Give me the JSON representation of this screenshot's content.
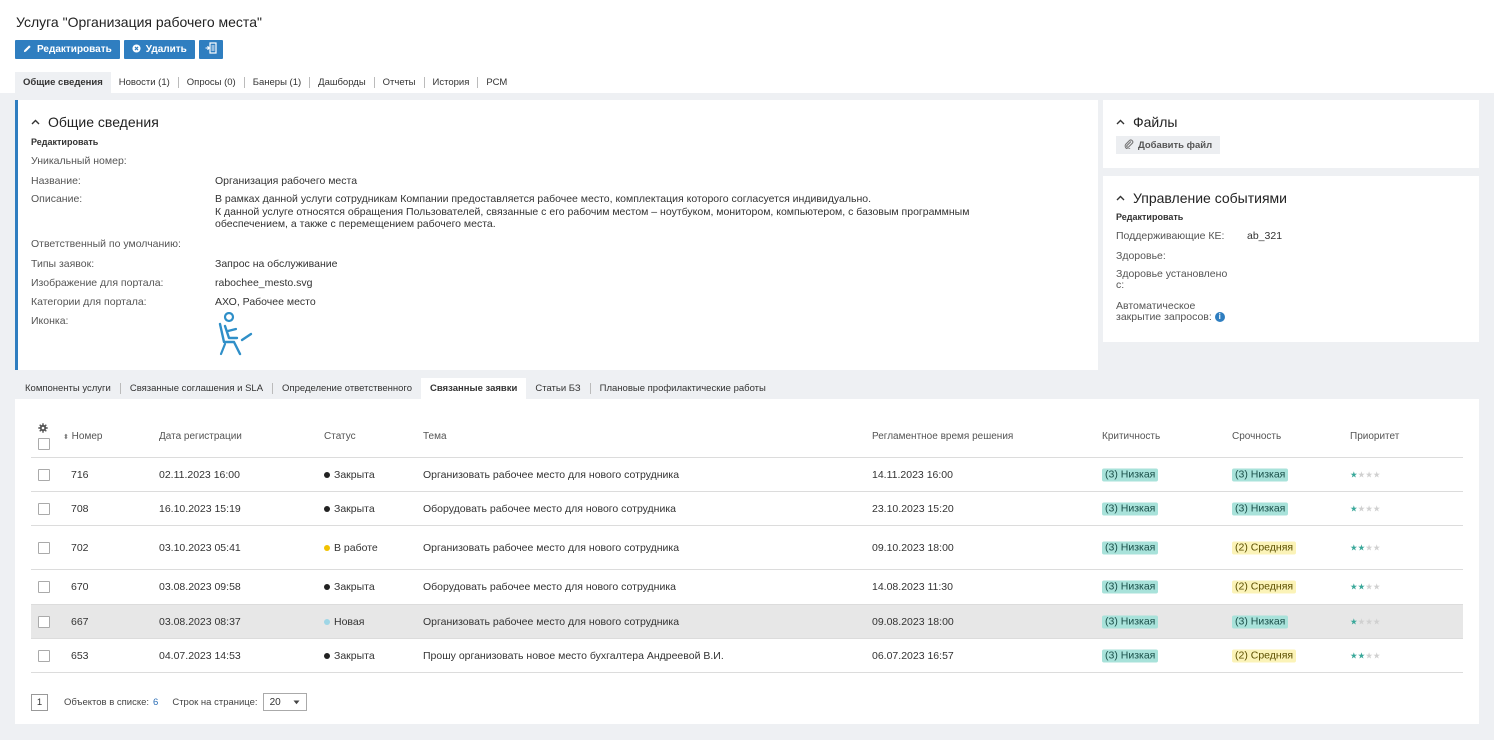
{
  "page": {
    "title": "Услуга \"Организация рабочего места\""
  },
  "toolbar": {
    "edit_label": "Редактировать",
    "delete_label": "Удалить"
  },
  "tabs": [
    {
      "label": "Общие сведения",
      "active": true
    },
    {
      "label": "Новости (1)"
    },
    {
      "label": "Опросы (0)"
    },
    {
      "label": "Банеры (1)"
    },
    {
      "label": "Дашборды"
    },
    {
      "label": "Отчеты"
    },
    {
      "label": "История"
    },
    {
      "label": "РСМ"
    }
  ],
  "general": {
    "title": "Общие сведения",
    "edit_label": "Редактировать",
    "fields": {
      "id_label": "Уникальный номер:",
      "name_label": "Название:",
      "name_value": "Организация рабочего места",
      "desc_label": "Описание:",
      "desc_line1": "В рамках данной услуги сотрудникам Компании предоставляется рабочее место, комплектация которого согласуется индивидуально.",
      "desc_line2": "К данной услуге относятся обращения Пользователей, связанные с его рабочим местом – ноутбуком, монитором, компьютером, с базовым программным",
      "desc_line3": "обеспечением, а также с перемещением рабочего места.",
      "resp_label": "Ответственный по умолчанию:",
      "types_label": "Типы заявок:",
      "types_value": "Запрос на обслуживание",
      "image_label": "Изображение для портала:",
      "image_value": "rabochee_mesto.svg",
      "cats_label": "Категории для портала:",
      "cats_value": "АХО, Рабочее место",
      "icon_label": "Иконка:"
    }
  },
  "files": {
    "title": "Файлы",
    "add_label": "Добавить файл"
  },
  "events": {
    "title": "Управление событиями",
    "edit_label": "Редактировать",
    "ke_label": "Поддерживающие КЕ:",
    "ke_value": "ab_321",
    "health_label": "Здоровье:",
    "health_since_line1": "Здоровье установлено",
    "health_since_line2": "с:",
    "autoclose_line1": "Автоматическое",
    "autoclose_line2": "закрытие запросов:"
  },
  "subtabs": [
    {
      "label": "Компоненты услуги"
    },
    {
      "label": "Связанные соглашения и SLA"
    },
    {
      "label": "Определение ответственного"
    },
    {
      "label": "Связанные заявки",
      "active": true
    },
    {
      "label": "Статьи БЗ"
    },
    {
      "label": "Плановые профилактические работы"
    }
  ],
  "table": {
    "columns": {
      "number": "Номер",
      "date": "Дата регистрации",
      "status": "Статус",
      "subject": "Тема",
      "deadline": "Регламентное время решения",
      "criticality": "Критичность",
      "urgency": "Срочность",
      "priority": "Приоритет"
    },
    "rows": [
      {
        "number": "716",
        "date": "02.11.2023 16:00",
        "status": "Закрыта",
        "subject": "Организовать рабочее место для нового сотрудника",
        "deadline": "14.11.2023 16:00",
        "criticality": "(3) Низкая",
        "urgency": "(3) Низкая",
        "priority_stars": 1
      },
      {
        "number": "708",
        "date": "16.10.2023 15:19",
        "status": "Закрыта",
        "subject": "Оборудовать рабочее место для нового сотрудника",
        "deadline": "23.10.2023 15:20",
        "criticality": "(3) Низкая",
        "urgency": "(3) Низкая",
        "priority_stars": 1
      },
      {
        "number": "702",
        "date": "03.10.2023 05:41",
        "status": "В работе",
        "subject": "Организовать рабочее место для нового сотрудника",
        "deadline": "09.10.2023 18:00",
        "criticality": "(3) Низкая",
        "urgency": "(2) Средняя",
        "priority_stars": 2
      },
      {
        "number": "670",
        "date": "03.08.2023 09:58",
        "status": "Закрыта",
        "subject": "Оборудовать рабочее место для нового сотрудника",
        "deadline": "14.08.2023 11:30",
        "criticality": "(3) Низкая",
        "urgency": "(2) Средняя",
        "priority_stars": 2
      },
      {
        "number": "667",
        "date": "03.08.2023 08:37",
        "status": "Новая",
        "subject": "Организовать рабочее место для нового сотрудника",
        "deadline": "09.08.2023 18:00",
        "criticality": "(3) Низкая",
        "urgency": "(3) Низкая",
        "priority_stars": 1
      },
      {
        "number": "653",
        "date": "04.07.2023 14:53",
        "status": "Закрыта",
        "subject": "Прошу организовать новое место бухгалтера Андреевой В.И.",
        "deadline": "06.07.2023 16:57",
        "criticality": "(3) Низкая",
        "urgency": "(2) Средняя",
        "priority_stars": 2
      }
    ]
  },
  "pager": {
    "page": "1",
    "objects_label": "Объектов в списке:",
    "objects_count": "6",
    "per_page_label": "Строк на странице:",
    "per_page_value": "20"
  },
  "colors": {
    "accent": "#2f7ec0",
    "status_closed": "#222222",
    "status_in_progress": "#f2c200",
    "status_new": "#9fd6e6",
    "badge_low": "#a8e2da",
    "badge_mid": "#fbf3b8"
  },
  "icons": [
    "pencil-icon",
    "delete-circle-icon",
    "export-icon",
    "paperclip-icon",
    "chevron-up-icon",
    "settings-gear-icon",
    "sort-icon",
    "info-icon",
    "workplace-person-icon",
    "dropdown-caret-icon",
    "star-icon"
  ]
}
